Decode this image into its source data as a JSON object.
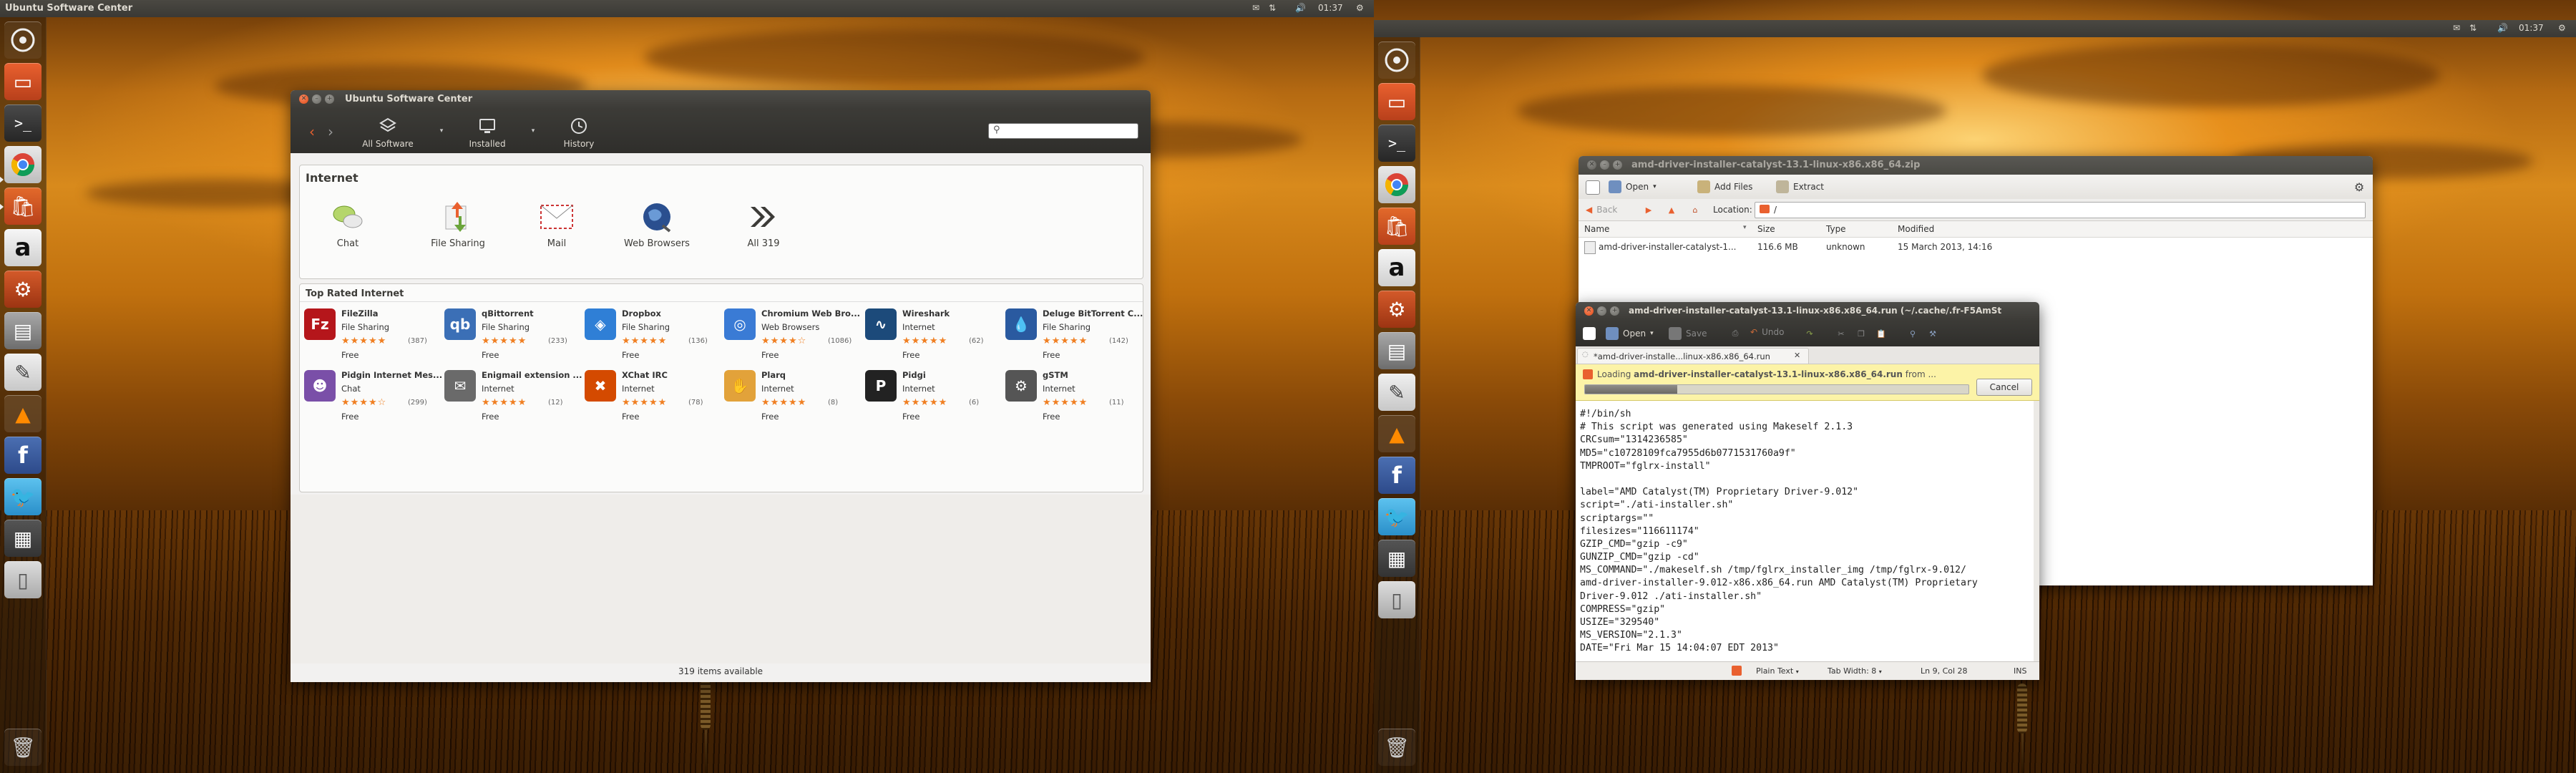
{
  "screen1": {
    "panel_title": "Ubuntu Software Center",
    "clock": "01:37"
  },
  "screen2": {
    "clock": "01:37"
  },
  "launcher_items": [
    "dash-home",
    "files",
    "terminal",
    "chrome",
    "software-center",
    "amazon",
    "system-settings",
    "disks",
    "text-editor",
    "vlc",
    "facebook",
    "twitter",
    "workspace-switcher",
    "trash-small"
  ],
  "usc": {
    "window_title": "Ubuntu Software Center",
    "toolbar": {
      "all_software": "All Software",
      "installed": "Installed",
      "history": "History"
    },
    "search_placeholder": "",
    "internet": {
      "heading": "Internet",
      "categories": [
        {
          "label": "Chat",
          "icon": "chat-icon"
        },
        {
          "label": "File Sharing",
          "icon": "file-sharing-icon"
        },
        {
          "label": "Mail",
          "icon": "mail-icon"
        },
        {
          "label": "Web Browsers",
          "icon": "web-browsers-icon"
        },
        {
          "label": "All 319",
          "icon": "all-icon"
        }
      ]
    },
    "top_rated": {
      "heading": "Top Rated Internet",
      "apps": [
        {
          "name": "FileZilla",
          "category": "File Sharing",
          "rating_count": "(387)",
          "price": "Free",
          "stars": 5,
          "color": "#b5161b",
          "glyph": "Fz"
        },
        {
          "name": "qBittorrent",
          "category": "File Sharing",
          "rating_count": "(233)",
          "price": "Free",
          "stars": 5,
          "color": "#3b6fb6",
          "glyph": "qb"
        },
        {
          "name": "Dropbox",
          "category": "File Sharing",
          "rating_count": "(136)",
          "price": "Free",
          "stars": 5,
          "color": "#2f7fd6",
          "glyph": "◈"
        },
        {
          "name": "Chromium Web Bro...",
          "category": "Web Browsers",
          "rating_count": "(1086)",
          "price": "Free",
          "stars": 4,
          "color": "#3a7bd5",
          "glyph": "◎"
        },
        {
          "name": "Wireshark",
          "category": "Internet",
          "rating_count": "(62)",
          "price": "Free",
          "stars": 5,
          "color": "#1c4a7a",
          "glyph": "∿"
        },
        {
          "name": "Deluge BitTorrent C...",
          "category": "File Sharing",
          "rating_count": "(142)",
          "price": "Free",
          "stars": 5,
          "color": "#2a5aa0",
          "glyph": "💧"
        },
        {
          "name": "Pidgin Internet Mes...",
          "category": "Chat",
          "rating_count": "(299)",
          "price": "Free",
          "stars": 4,
          "color": "#7a4fa8",
          "glyph": "☻"
        },
        {
          "name": "Enigmail extension ...",
          "category": "Internet",
          "rating_count": "(12)",
          "price": "Free",
          "stars": 5,
          "color": "#6a6a6a",
          "glyph": "✉"
        },
        {
          "name": "XChat IRC",
          "category": "Internet",
          "rating_count": "(78)",
          "price": "Free",
          "stars": 5,
          "color": "#d44a00",
          "glyph": "✖"
        },
        {
          "name": "Plarq",
          "category": "Internet",
          "rating_count": "(8)",
          "price": "Free",
          "stars": 5,
          "color": "#e2a23a",
          "glyph": "✋"
        },
        {
          "name": "Pidgi",
          "category": "Internet",
          "rating_count": "(6)",
          "price": "Free",
          "stars": 5,
          "color": "#222222",
          "glyph": "P"
        },
        {
          "name": "gSTM",
          "category": "Internet",
          "rating_count": "(11)",
          "price": "Free",
          "stars": 5,
          "color": "#555555",
          "glyph": "⚙"
        }
      ]
    },
    "status": "319 items available"
  },
  "fileroller": {
    "window_title": "amd-driver-installer-catalyst-13.1-linux-x86.x86_64.zip",
    "toolbar": {
      "open": "Open",
      "add_files": "Add Files",
      "extract": "Extract"
    },
    "nav": {
      "back": "Back",
      "location_label": "Location:",
      "location_value": "/"
    },
    "columns": {
      "name": "Name",
      "size": "Size",
      "type": "Type",
      "modified": "Modified"
    },
    "rows": [
      {
        "name": "amd-driver-installer-catalyst-1...",
        "size": "116.6 MB",
        "type": "unknown",
        "modified": "15 March 2013, 14:16"
      }
    ]
  },
  "gedit": {
    "window_title": "amd-driver-installer-catalyst-13.1-linux-x86.x86_64.run (~/.cache/.fr-F5AmSt",
    "toolbar": {
      "open": "Open",
      "save": "Save",
      "undo": "Undo"
    },
    "tab_label": "*amd-driver-installe...linux-x86.x86_64.run",
    "loading_prefix": "Loading",
    "loading_file": "amd-driver-installer-catalyst-13.1-linux-x86.x86_64.run",
    "loading_suffix": "from ...",
    "loading_progress": 0.24,
    "cancel": "Cancel",
    "code": [
      "#!/bin/sh",
      "# This script was generated using Makeself 2.1.3",
      "CRCsum=\"1314236585\"",
      "MD5=\"c10728109fca7955d6b0771531760a9f\"",
      "TMPROOT=\"fglrx-install\"",
      "",
      "label=\"AMD Catalyst(TM) Proprietary Driver-9.012\"",
      "script=\"./ati-installer.sh\"",
      "scriptargs=\"\"",
      "filesizes=\"116611174\"",
      "GZIP_CMD=\"gzip -c9\"",
      "GUNZIP_CMD=\"gzip -cd\"",
      "MS_COMMAND=\"./makeself.sh /tmp/fglrx_installer_img /tmp/fglrx-9.012/",
      "amd-driver-installer-9.012-x86.x86_64.run AMD Catalyst(TM) Proprietary",
      "Driver-9.012 ./ati-installer.sh\"",
      "COMPRESS=\"gzip\"",
      "USIZE=\"329540\"",
      "MS_VERSION=\"2.1.3\"",
      "DATE=\"Fri Mar 15 14:04:07 EDT 2013\""
    ],
    "status": {
      "language": "Plain Text",
      "tab_width": "Tab Width: 8",
      "position": "Ln 9, Col 28",
      "mode": "INS"
    }
  }
}
